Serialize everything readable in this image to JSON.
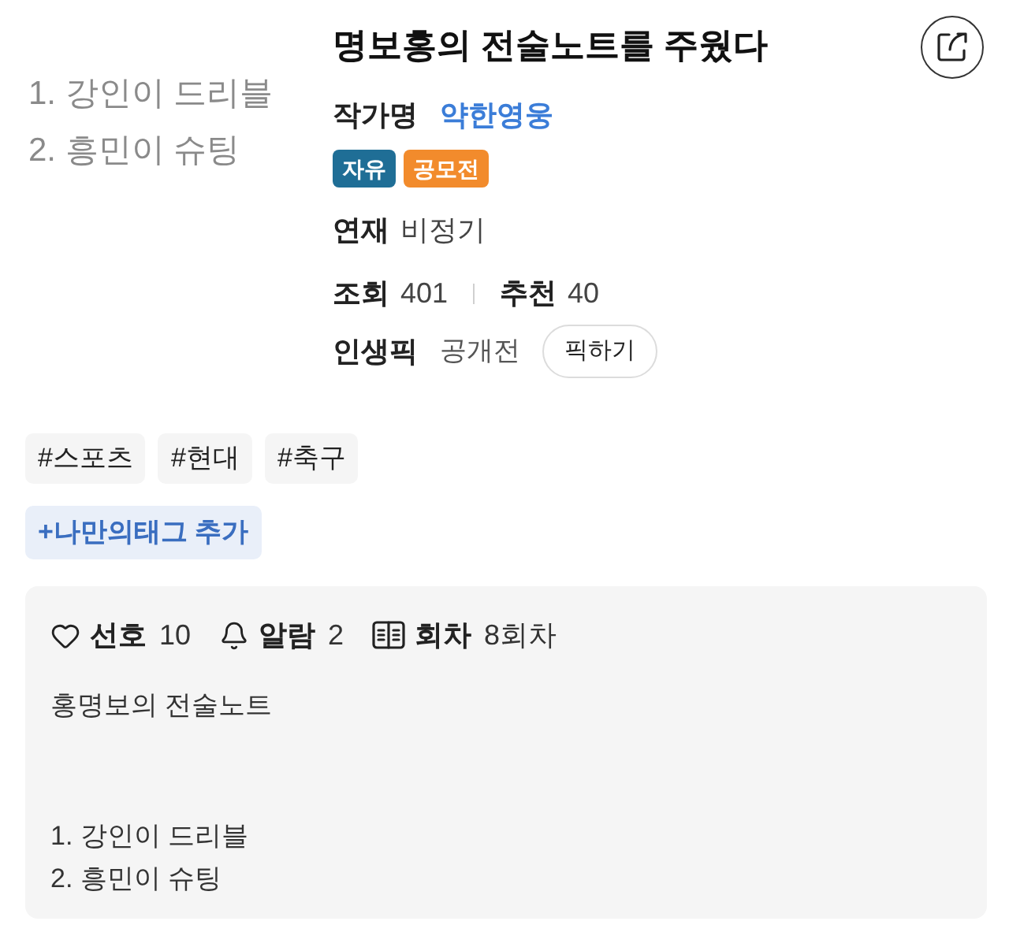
{
  "cover": {
    "handwriting": [
      "1. 강인이 드리블",
      "2. 흥민이 슈팅"
    ]
  },
  "title": "명보홍의 전술노트를 주웠다",
  "author": {
    "label": "작가명",
    "name": "약한영웅"
  },
  "badges": [
    {
      "label": "자유",
      "color": "#1f6e96"
    },
    {
      "label": "공모전",
      "color": "#f28b2c"
    }
  ],
  "serial": {
    "label": "연재",
    "value": "비정기"
  },
  "stats": [
    {
      "label": "조회",
      "value": "401"
    },
    {
      "label": "추천",
      "value": "40"
    }
  ],
  "life_pick": {
    "label": "인생픽",
    "value": "공개전",
    "button": "픽하기"
  },
  "hashtags": [
    "#스포츠",
    "#현대",
    "#축구"
  ],
  "add_tag_button": "+나만의태그 추가",
  "counters": [
    {
      "kind": "heart",
      "label": "선호",
      "value": "10"
    },
    {
      "kind": "bell",
      "label": "알람",
      "value": "2"
    },
    {
      "kind": "book",
      "label": "회차",
      "value": "8회차"
    }
  ],
  "description": "홍명보의 전술노트\n\n\n1. 강인이 드리블\n2. 흥민이 슈팅"
}
